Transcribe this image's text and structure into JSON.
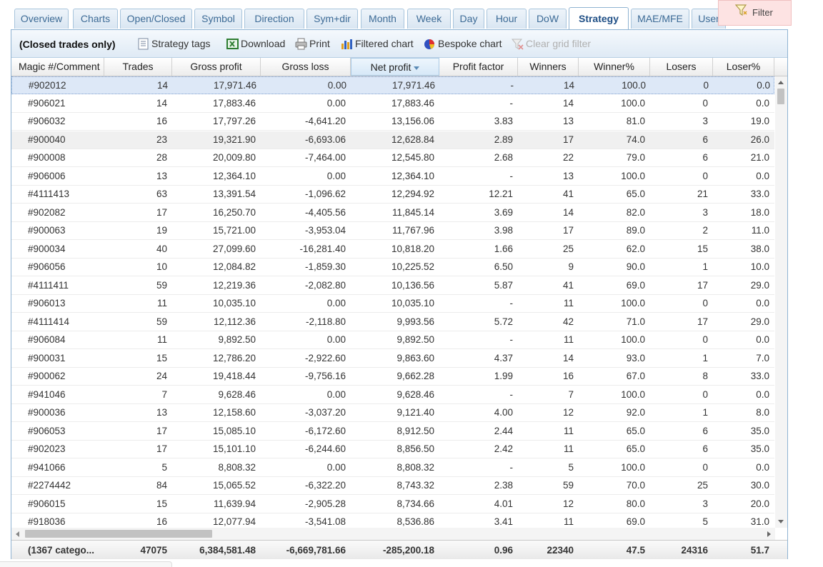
{
  "tabs": [
    {
      "label": "Overview"
    },
    {
      "label": "Charts"
    },
    {
      "label": "Open/Closed"
    },
    {
      "label": "Symbol"
    },
    {
      "label": "Direction"
    },
    {
      "label": "Sym+dir"
    },
    {
      "label": "Month"
    },
    {
      "label": "Week"
    },
    {
      "label": "Day"
    },
    {
      "label": "Hour"
    },
    {
      "label": "DoW"
    },
    {
      "label": "Strategy",
      "active": true
    },
    {
      "label": "MAE/MFE"
    },
    {
      "label": "User"
    }
  ],
  "filter": {
    "label": "Filter",
    "icon": "filter-funnel-icon"
  },
  "toolbar": {
    "title": "(Closed trades only)",
    "strategy_tags": "Strategy tags",
    "download": "Download",
    "print": "Print",
    "filtered_chart": "Filtered chart",
    "bespoke_chart": "Bespoke chart",
    "clear_grid_filter": "Clear grid filter"
  },
  "columns": [
    "Magic #/Comment",
    "Trades",
    "Gross profit",
    "Gross loss",
    "Net profit",
    "Profit factor",
    "Winners",
    "Winner%",
    "Losers",
    "Loser%"
  ],
  "sorted_column": "Net profit",
  "rows": [
    [
      "#902012",
      "14",
      "17,971.46",
      "0.00",
      "17,971.46",
      "-",
      "14",
      "100.0",
      "0",
      "0.0"
    ],
    [
      "#906021",
      "14",
      "17,883.46",
      "0.00",
      "17,883.46",
      "-",
      "14",
      "100.0",
      "0",
      "0.0"
    ],
    [
      "#906032",
      "16",
      "17,797.26",
      "-4,641.20",
      "13,156.06",
      "3.83",
      "13",
      "81.0",
      "3",
      "19.0"
    ],
    [
      "#900040",
      "23",
      "19,321.90",
      "-6,693.06",
      "12,628.84",
      "2.89",
      "17",
      "74.0",
      "6",
      "26.0"
    ],
    [
      "#900008",
      "28",
      "20,009.80",
      "-7,464.00",
      "12,545.80",
      "2.68",
      "22",
      "79.0",
      "6",
      "21.0"
    ],
    [
      "#906006",
      "13",
      "12,364.10",
      "0.00",
      "12,364.10",
      "-",
      "13",
      "100.0",
      "0",
      "0.0"
    ],
    [
      "#4111413",
      "63",
      "13,391.54",
      "-1,096.62",
      "12,294.92",
      "12.21",
      "41",
      "65.0",
      "21",
      "33.0"
    ],
    [
      "#902082",
      "17",
      "16,250.70",
      "-4,405.56",
      "11,845.14",
      "3.69",
      "14",
      "82.0",
      "3",
      "18.0"
    ],
    [
      "#900063",
      "19",
      "15,721.00",
      "-3,953.04",
      "11,767.96",
      "3.98",
      "17",
      "89.0",
      "2",
      "11.0"
    ],
    [
      "#900034",
      "40",
      "27,099.60",
      "-16,281.40",
      "10,818.20",
      "1.66",
      "25",
      "62.0",
      "15",
      "38.0"
    ],
    [
      "#906056",
      "10",
      "12,084.82",
      "-1,859.30",
      "10,225.52",
      "6.50",
      "9",
      "90.0",
      "1",
      "10.0"
    ],
    [
      "#4111411",
      "59",
      "12,219.36",
      "-2,082.80",
      "10,136.56",
      "5.87",
      "41",
      "69.0",
      "17",
      "29.0"
    ],
    [
      "#906013",
      "11",
      "10,035.10",
      "0.00",
      "10,035.10",
      "-",
      "11",
      "100.0",
      "0",
      "0.0"
    ],
    [
      "#4111414",
      "59",
      "12,112.36",
      "-2,118.80",
      "9,993.56",
      "5.72",
      "42",
      "71.0",
      "17",
      "29.0"
    ],
    [
      "#906084",
      "11",
      "9,892.50",
      "0.00",
      "9,892.50",
      "-",
      "11",
      "100.0",
      "0",
      "0.0"
    ],
    [
      "#900031",
      "15",
      "12,786.20",
      "-2,922.60",
      "9,863.60",
      "4.37",
      "14",
      "93.0",
      "1",
      "7.0"
    ],
    [
      "#900062",
      "24",
      "19,418.44",
      "-9,756.16",
      "9,662.28",
      "1.99",
      "16",
      "67.0",
      "8",
      "33.0"
    ],
    [
      "#941046",
      "7",
      "9,628.46",
      "0.00",
      "9,628.46",
      "-",
      "7",
      "100.0",
      "0",
      "0.0"
    ],
    [
      "#900036",
      "13",
      "12,158.60",
      "-3,037.20",
      "9,121.40",
      "4.00",
      "12",
      "92.0",
      "1",
      "8.0"
    ],
    [
      "#906053",
      "17",
      "15,085.10",
      "-6,172.60",
      "8,912.50",
      "2.44",
      "11",
      "65.0",
      "6",
      "35.0"
    ],
    [
      "#902023",
      "17",
      "15,101.10",
      "-6,244.60",
      "8,856.50",
      "2.42",
      "11",
      "65.0",
      "6",
      "35.0"
    ],
    [
      "#941066",
      "5",
      "8,808.32",
      "0.00",
      "8,808.32",
      "-",
      "5",
      "100.0",
      "0",
      "0.0"
    ],
    [
      "#2274442",
      "84",
      "15,065.52",
      "-6,322.20",
      "8,743.32",
      "2.38",
      "59",
      "70.0",
      "25",
      "30.0"
    ],
    [
      "#906015",
      "15",
      "11,639.94",
      "-2,905.28",
      "8,734.66",
      "4.01",
      "12",
      "80.0",
      "3",
      "20.0"
    ],
    [
      "#918036",
      "16",
      "12,077.94",
      "-3,541.08",
      "8,536.86",
      "3.41",
      "11",
      "69.0",
      "5",
      "31.0"
    ]
  ],
  "totals": [
    "(1367 catego...",
    "47075",
    "6,384,581.48",
    "-6,669,781.66",
    "-285,200.18",
    "0.96",
    "22340",
    "47.5",
    "24316",
    "51.7"
  ]
}
